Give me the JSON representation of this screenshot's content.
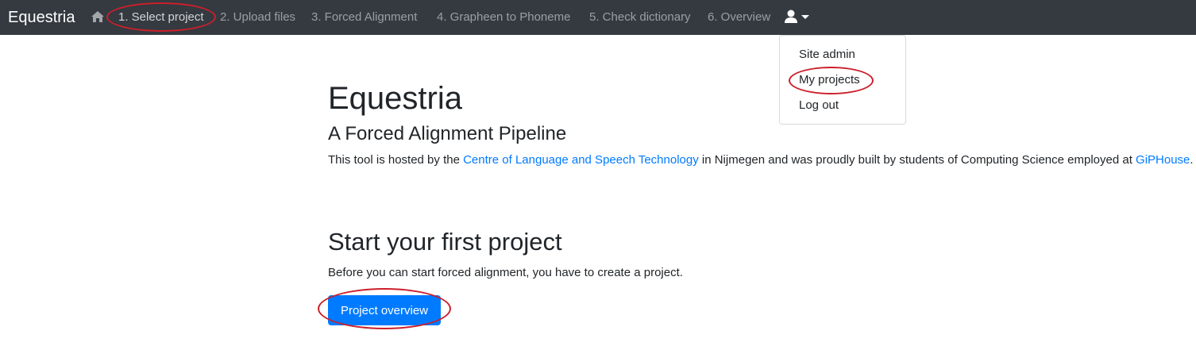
{
  "nav": {
    "brand": "Equestria",
    "home_icon": "home-icon",
    "steps": [
      "1. Select project",
      "2. Upload files",
      "3. Forced Alignment",
      "4. Grapheen to Phoneme",
      "5. Check dictionary",
      "6. Overview"
    ],
    "active_step": "1. Select project",
    "user_icon": "user-icon"
  },
  "user_menu": {
    "items": [
      "Site admin",
      "My projects",
      "Log out"
    ]
  },
  "main": {
    "title": "Equestria",
    "subtitle": "A Forced Alignment Pipeline",
    "intro": {
      "before": "This tool is hosted by the ",
      "link1": "Centre of Language and Speech Technology",
      "middle": " in Nijmegen and was proudly built by students of Computing Science employed at ",
      "link2": "GiPHouse",
      "after": "."
    },
    "section_heading": "Start your first project",
    "section_text": "Before you can start forced alignment, you have to create a project.",
    "button_label": "Project overview"
  },
  "colors": {
    "navbar_bg": "#343a40",
    "link": "#007bff",
    "button": "#007bff",
    "annotation": "#cc1f2b"
  }
}
